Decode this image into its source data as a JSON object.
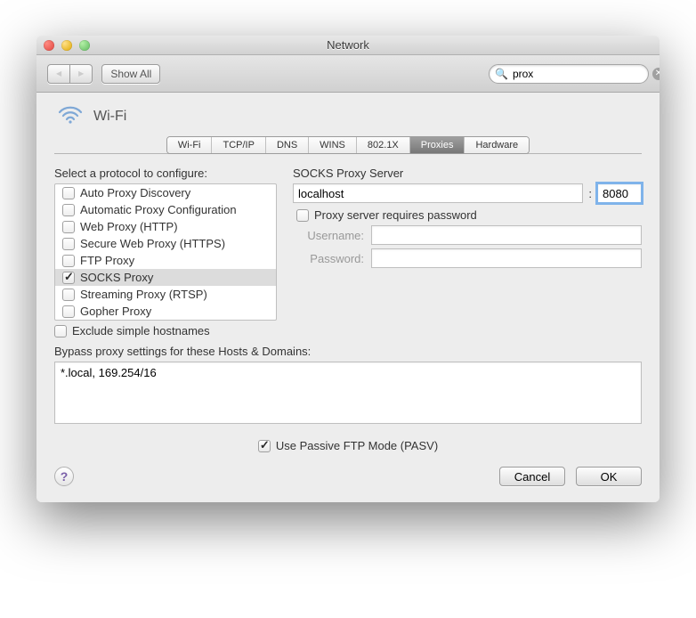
{
  "window": {
    "title": "Network"
  },
  "toolbar": {
    "show_all": "Show All",
    "search_value": "prox"
  },
  "header": {
    "connection": "Wi-Fi"
  },
  "tabs": [
    "Wi-Fi",
    "TCP/IP",
    "DNS",
    "WINS",
    "802.1X",
    "Proxies",
    "Hardware"
  ],
  "active_tab": "Proxies",
  "left": {
    "label": "Select a protocol to configure:",
    "protocols": [
      {
        "label": "Auto Proxy Discovery",
        "checked": false
      },
      {
        "label": "Automatic Proxy Configuration",
        "checked": false
      },
      {
        "label": "Web Proxy (HTTP)",
        "checked": false
      },
      {
        "label": "Secure Web Proxy (HTTPS)",
        "checked": false
      },
      {
        "label": "FTP Proxy",
        "checked": false
      },
      {
        "label": "SOCKS Proxy",
        "checked": true
      },
      {
        "label": "Streaming Proxy (RTSP)",
        "checked": false
      },
      {
        "label": "Gopher Proxy",
        "checked": false
      }
    ],
    "selected_index": 5,
    "exclude_label": "Exclude simple hostnames",
    "exclude_checked": false
  },
  "right": {
    "server_label": "SOCKS Proxy Server",
    "host": "localhost",
    "port": "8080",
    "requires_pw_label": "Proxy server requires password",
    "requires_pw_checked": false,
    "username_label": "Username:",
    "password_label": "Password:",
    "username": "",
    "password": ""
  },
  "bypass": {
    "label": "Bypass proxy settings for these Hosts & Domains:",
    "value": "*.local, 169.254/16"
  },
  "pasv": {
    "label": "Use Passive FTP Mode (PASV)",
    "checked": true
  },
  "footer": {
    "cancel": "Cancel",
    "ok": "OK"
  }
}
